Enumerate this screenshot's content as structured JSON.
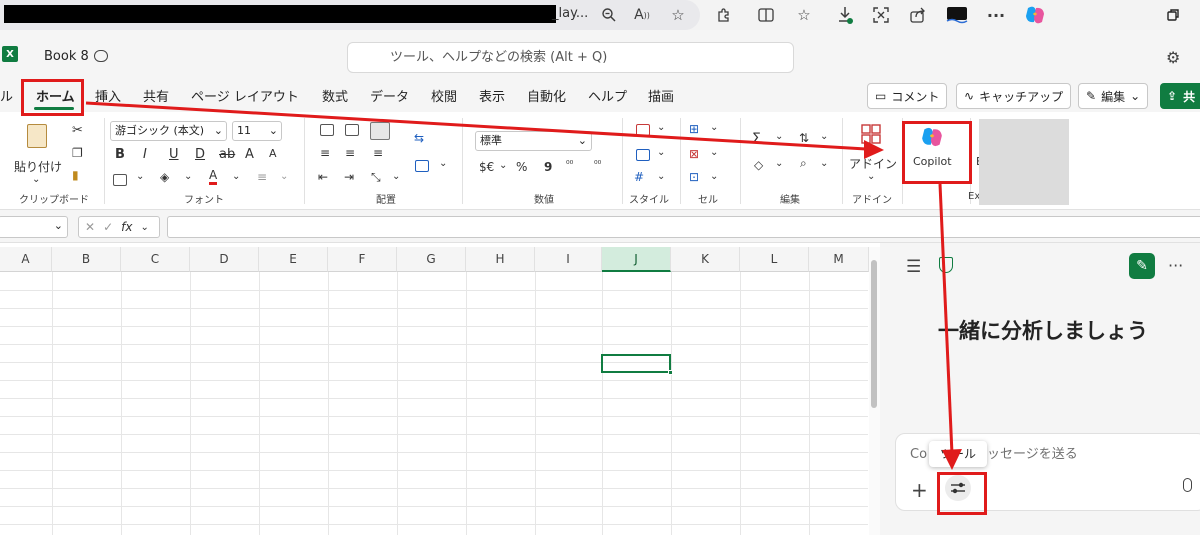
{
  "browser": {
    "url_suffix": "_lay...",
    "icons": [
      "zoom-icon",
      "read-aloud-icon",
      "favorite-star-icon",
      "extensions-icon",
      "split-screen-icon",
      "favorites-icon",
      "downloads-icon",
      "screenshot-icon",
      "share-icon",
      "wallet-icon",
      "more-icon",
      "copilot-icon",
      "restore-icon"
    ]
  },
  "titlebar": {
    "app_icon": "X",
    "book_title": "Book 8",
    "search_placeholder": "ツール、ヘルプなどの検索 (Alt + Q)"
  },
  "tabs": [
    "ル",
    "ホーム",
    "挿入",
    "共有",
    "ページ レイアウト",
    "数式",
    "データ",
    "校閲",
    "表示",
    "自動化",
    "ヘルプ",
    "描画"
  ],
  "active_tab": "ホーム",
  "tab_buttons": {
    "comment": "コメント",
    "catchup": "キャッチアップ",
    "edit": "編集",
    "share": "共"
  },
  "ribbon": {
    "paste_label": "貼り付け",
    "font_name": "游ゴシック (本文)",
    "font_size": "11",
    "number_format": "標準",
    "currency": "$€",
    "percent": "%",
    "comma": "9",
    "addin_label": "アドイン",
    "copilot_label": "Copilot",
    "groups": {
      "clipboard": "クリップボード",
      "font": "フォント",
      "alignment": "配置",
      "number": "数値",
      "style": "スタイル",
      "cells": "セル",
      "edit": "編集",
      "addin": "アドイン",
      "excel": "Exc"
    },
    "text_style_buttons": [
      "B",
      "I",
      "U",
      "D",
      "A",
      "A"
    ],
    "truncated_label": "E"
  },
  "formula_bar": {
    "cancel": "✕",
    "confirm": "✓",
    "fx": "fx"
  },
  "grid": {
    "columns": [
      "A",
      "B",
      "C",
      "D",
      "E",
      "F",
      "G",
      "H",
      "I",
      "J",
      "K",
      "L",
      "M"
    ],
    "selected_column": "J"
  },
  "copilot_pane": {
    "heading": "一緒に分析しましょう",
    "input_placeholder": "Copilot にメッセージを送る",
    "input_placeholder_prefix": "Co",
    "input_placeholder_visible": "ッセージを送る",
    "tooltip": "ツール"
  },
  "colors": {
    "excel_green": "#107c41",
    "annotation_red": "#e01b1b"
  }
}
